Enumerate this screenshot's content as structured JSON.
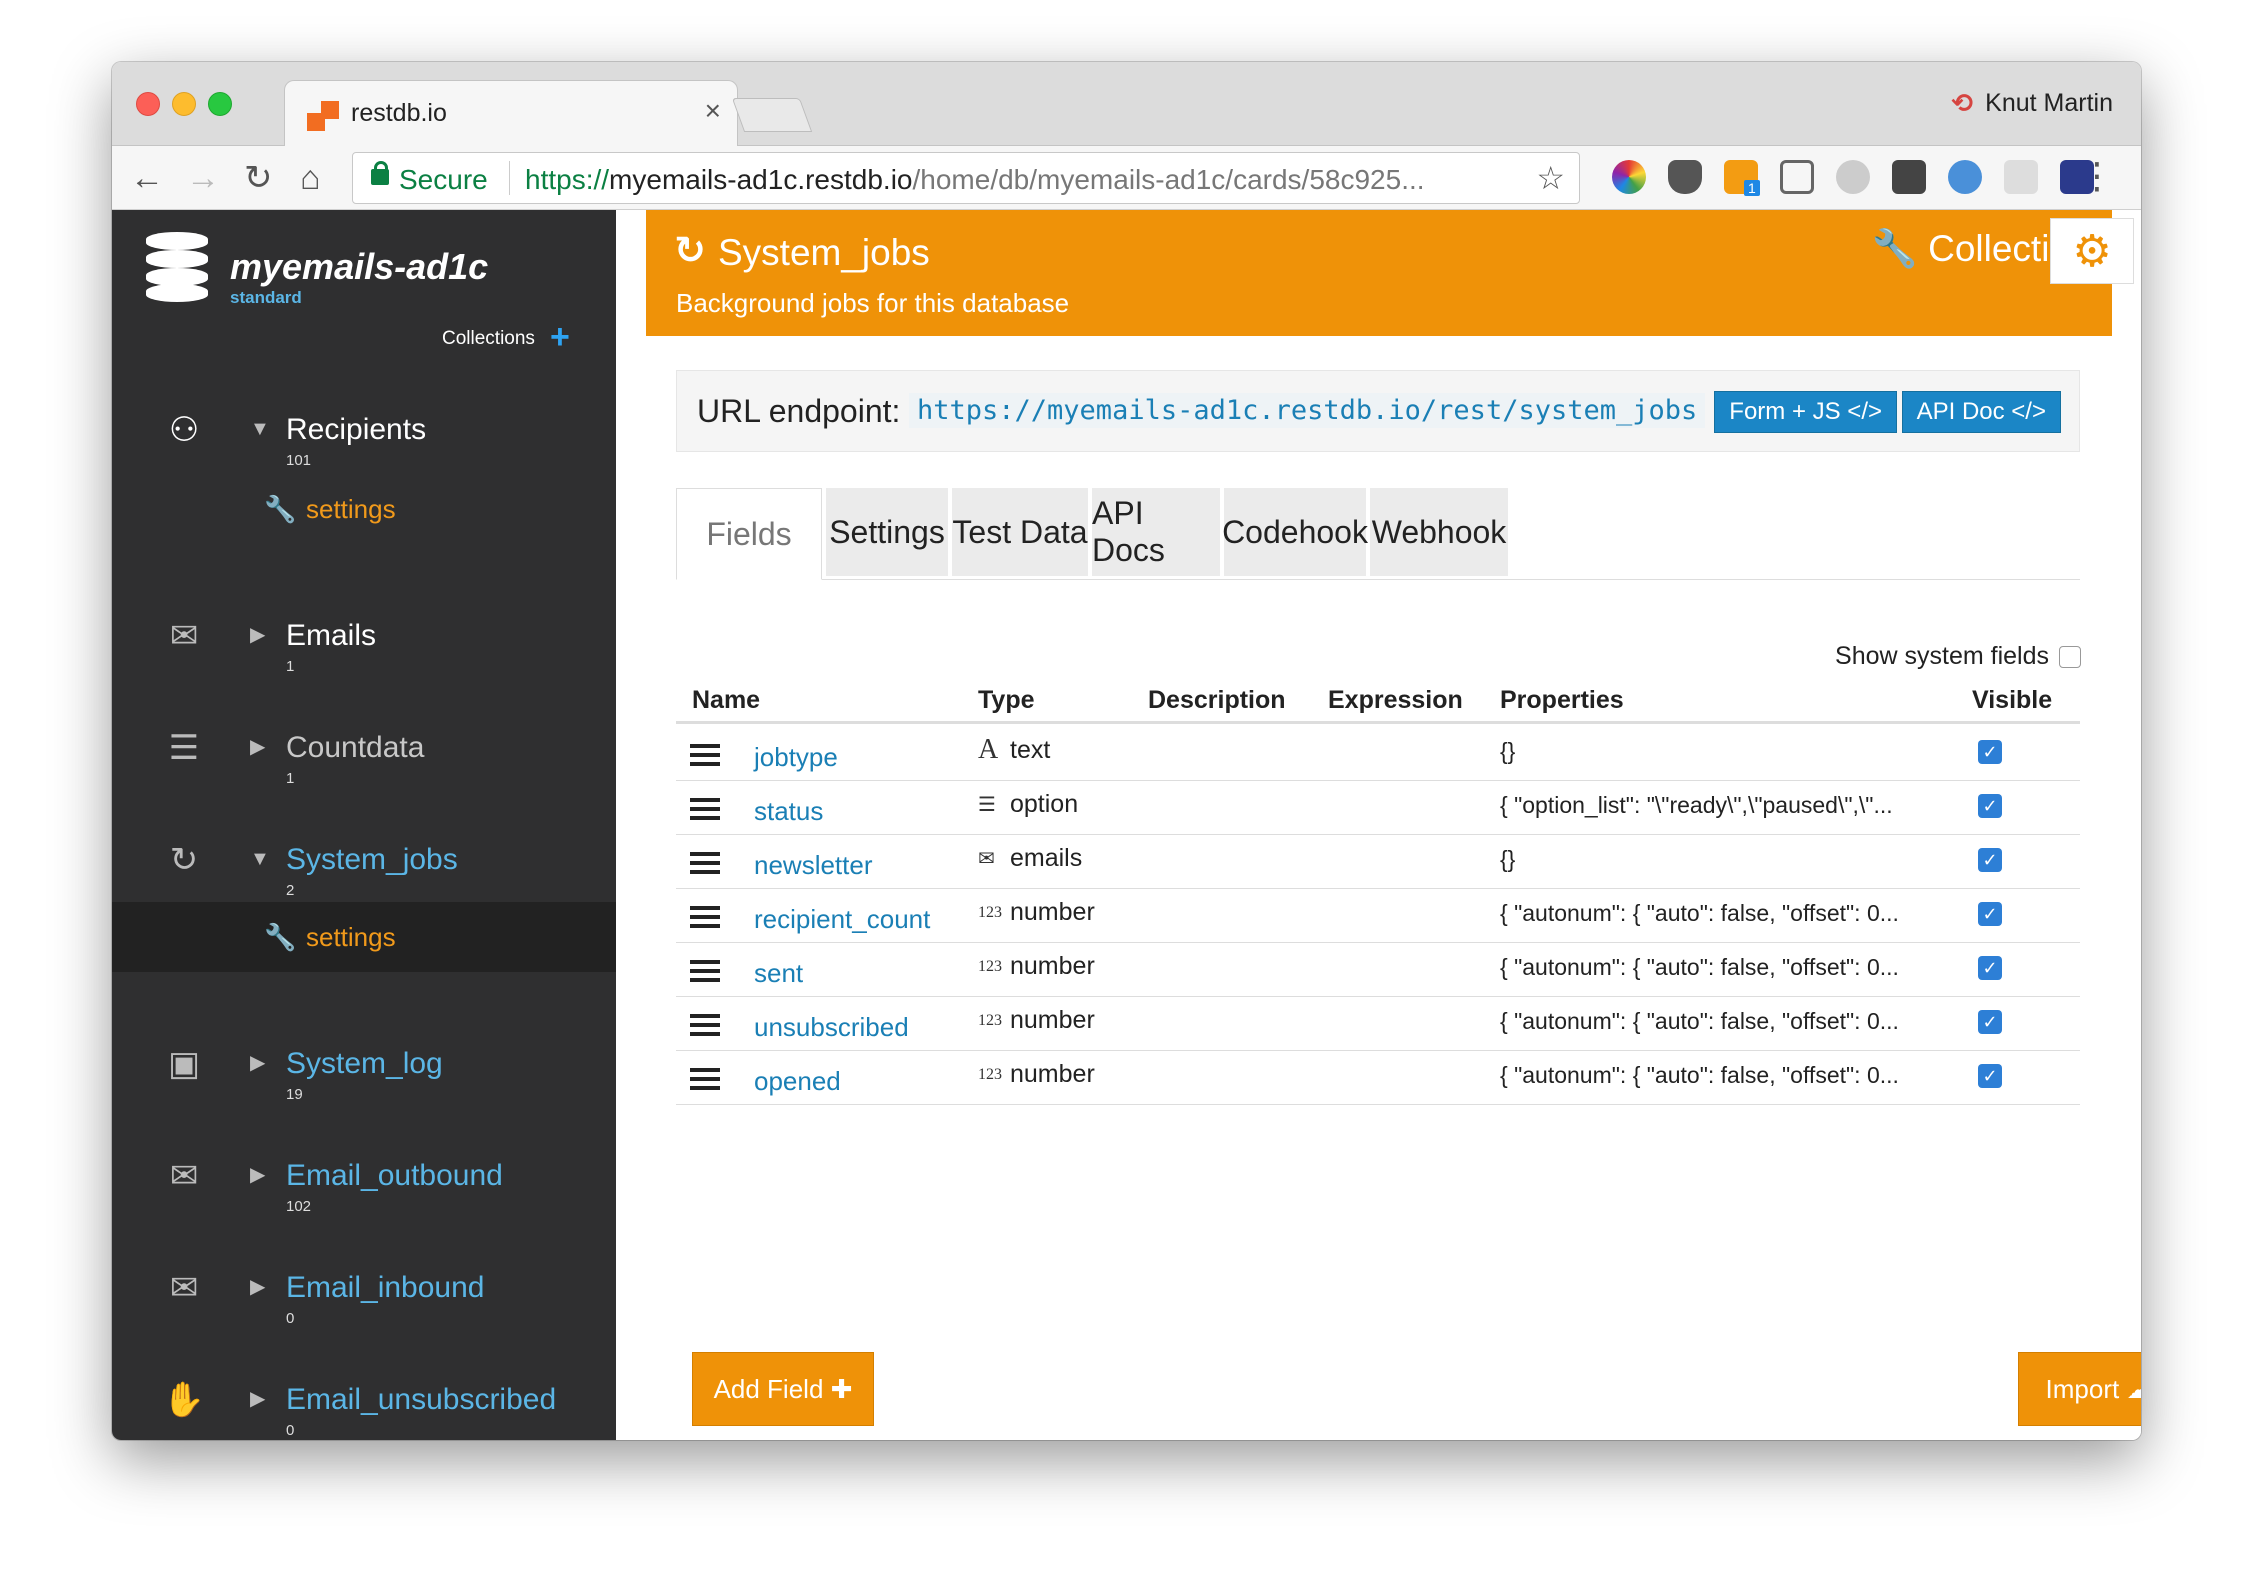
{
  "browser": {
    "tab_title": "restdb.io",
    "tab_close": "×",
    "profile_name": "Knut Martin",
    "secure_label": "Secure",
    "url_scheme": "https://",
    "url_host": "myemails-ad1c.restdb.io",
    "url_path": "/home/db/myemails-ad1c/cards/58c925...",
    "extension_badge": "1"
  },
  "sidebar": {
    "db_name": "myemails-ad1c",
    "db_plan": "standard",
    "collections_label": "Collections",
    "collections": [
      {
        "name": "Recipients",
        "count": "101",
        "icon": "users-icon",
        "expanded": true
      },
      {
        "name": "Emails",
        "count": "1",
        "icon": "envelope-icon",
        "expanded": false
      },
      {
        "name": "Countdata",
        "count": "1",
        "icon": "list-numbered-icon",
        "expanded": false
      },
      {
        "name": "System_jobs",
        "count": "2",
        "icon": "refresh-icon",
        "expanded": true
      },
      {
        "name": "System_log",
        "count": "19",
        "icon": "terminal-icon",
        "expanded": false
      },
      {
        "name": "Email_outbound",
        "count": "102",
        "icon": "envelope-icon",
        "expanded": false
      },
      {
        "name": "Email_inbound",
        "count": "0",
        "icon": "envelope-icon",
        "expanded": false
      },
      {
        "name": "Email_unsubscribed",
        "count": "0",
        "icon": "hand-icon",
        "expanded": false
      }
    ],
    "settings_label": "settings"
  },
  "header": {
    "title": "System_jobs",
    "subtitle": "Background jobs for this database",
    "collection_link": "Collectio"
  },
  "endpoint": {
    "label": "URL endpoint:",
    "url": "https://myemails-ad1c.restdb.io/rest/system_jobs",
    "btn_form": "Form + JS </>",
    "btn_api": "API Doc </>"
  },
  "tabs": [
    "Fields",
    "Settings",
    "Test Data",
    "API Docs",
    "Codehook",
    "Webhook"
  ],
  "show_system_fields": "Show system fields",
  "table": {
    "columns": [
      "Name",
      "Type",
      "Description",
      "Expression",
      "Properties",
      "Visible"
    ],
    "rows": [
      {
        "name": "jobtype",
        "type_icon": "A",
        "type": "text",
        "properties": "{}",
        "visible": true
      },
      {
        "name": "status",
        "type_icon": "☰",
        "type": "option",
        "properties": "{ \"option_list\": \"\\\"ready\\\",\\\"paused\\\",\\\"...",
        "visible": true
      },
      {
        "name": "newsletter",
        "type_icon": "✉",
        "type": "emails",
        "properties": "{}",
        "visible": true
      },
      {
        "name": "recipient_count",
        "type_icon": "123",
        "type": "number",
        "properties": "{ \"autonum\": { \"auto\": false, \"offset\": 0...",
        "visible": true
      },
      {
        "name": "sent",
        "type_icon": "123",
        "type": "number",
        "properties": "{ \"autonum\": { \"auto\": false, \"offset\": 0...",
        "visible": true
      },
      {
        "name": "unsubscribed",
        "type_icon": "123",
        "type": "number",
        "properties": "{ \"autonum\": { \"auto\": false, \"offset\": 0...",
        "visible": true
      },
      {
        "name": "opened",
        "type_icon": "123",
        "type": "number",
        "properties": "{ \"autonum\": { \"auto\": false, \"offset\": 0...",
        "visible": true
      }
    ]
  },
  "buttons": {
    "add_field": "Add Field ✚",
    "import": "Import ☁"
  },
  "colors": {
    "accent_orange": "#ef9208",
    "link_blue": "#1a7fb5",
    "sidebar_bg": "#2f2f30",
    "button_blue": "#1b86c6"
  }
}
